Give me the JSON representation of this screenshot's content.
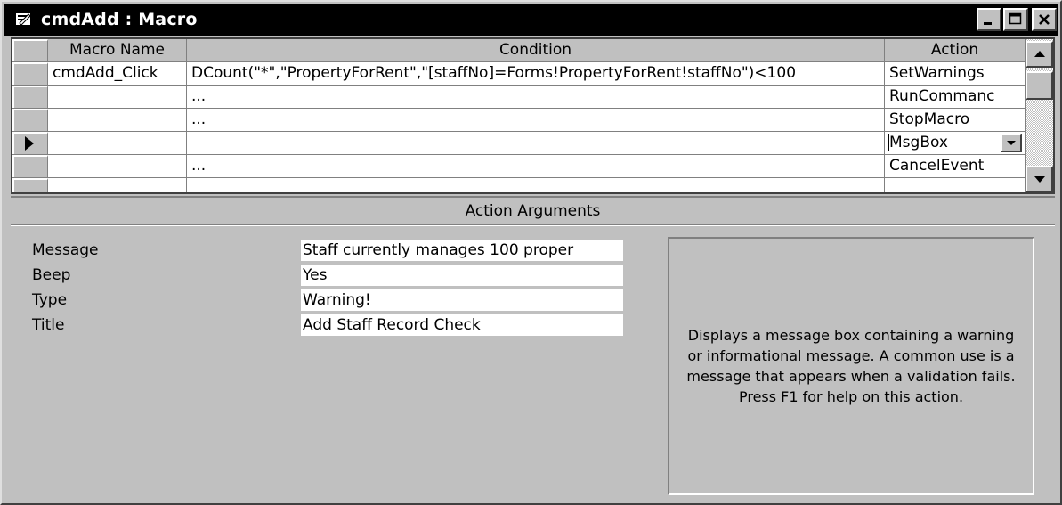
{
  "window": {
    "title": "cmdAdd : Macro"
  },
  "grid": {
    "headers": {
      "macro_name": "Macro Name",
      "condition": "Condition",
      "action": "Action"
    },
    "rows": [
      {
        "macro_name": "cmdAdd_Click",
        "condition": "DCount(\"*\",\"PropertyForRent\",\"[staffNo]=Forms!PropertyForRent!staffNo\")<100",
        "action": "SetWarnings"
      },
      {
        "macro_name": "",
        "condition": "...",
        "action": "RunCommanc"
      },
      {
        "macro_name": "",
        "condition": "...",
        "action": "StopMacro"
      },
      {
        "macro_name": "",
        "condition": "",
        "action": "MsgBox"
      },
      {
        "macro_name": "",
        "condition": "...",
        "action": "CancelEvent"
      }
    ]
  },
  "action_arguments": {
    "heading": "Action Arguments",
    "items": [
      {
        "label": "Message",
        "value": "Staff currently manages 100 proper"
      },
      {
        "label": "Beep",
        "value": "Yes"
      },
      {
        "label": "Type",
        "value": "Warning!"
      },
      {
        "label": "Title",
        "value": "Add Staff Record Check"
      }
    ],
    "help_text": "Displays a message box containing a warning or informational message. A common use is a message that appears when a validation fails. Press F1 for help on this action."
  }
}
